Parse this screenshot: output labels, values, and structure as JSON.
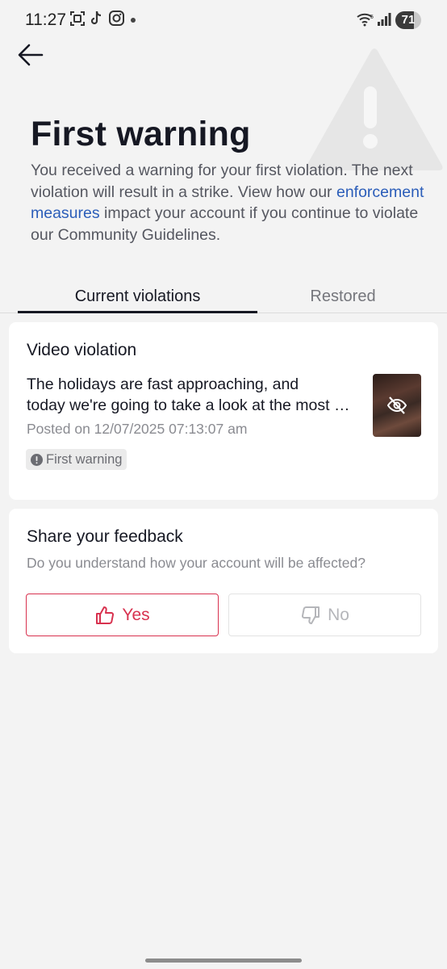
{
  "status_bar": {
    "time": "11:27",
    "battery_level": 71,
    "battery_text": "71",
    "icons": [
      "screenshot-icon",
      "tiktok-icon",
      "instagram-icon",
      "notification-dot-icon",
      "wifi-icon",
      "signal-icon",
      "battery-icon"
    ]
  },
  "header": {
    "title": "First warning",
    "description_before_link": "You received a warning for your first violation. The next violation will result in a strike. View how our ",
    "link_text": "enforcement measures",
    "description_after_link": " impact your account if you continue to violate our Community Guidelines."
  },
  "tabs": [
    {
      "label": "Current violations",
      "active": true
    },
    {
      "label": "Restored",
      "active": false
    }
  ],
  "violation": {
    "title": "Video violation",
    "text_line1": "The holidays are fast approaching, and",
    "text_line2": "today we're going to take a look at the most popular gifts for the season",
    "posted": "Posted on 12/07/2025 07:13:07 am",
    "badge": "First warning",
    "thumbnail_icon": "eye-off-icon"
  },
  "feedback": {
    "title": "Share your feedback",
    "question": "Do you understand how your account will be affected?",
    "yes_label": "Yes",
    "no_label": "No"
  },
  "colors": {
    "accent_red": "#d8324f",
    "link_blue": "#2b5db9",
    "background": "#f3f3f3",
    "text_primary": "#161823",
    "text_secondary": "#8a8b91"
  }
}
